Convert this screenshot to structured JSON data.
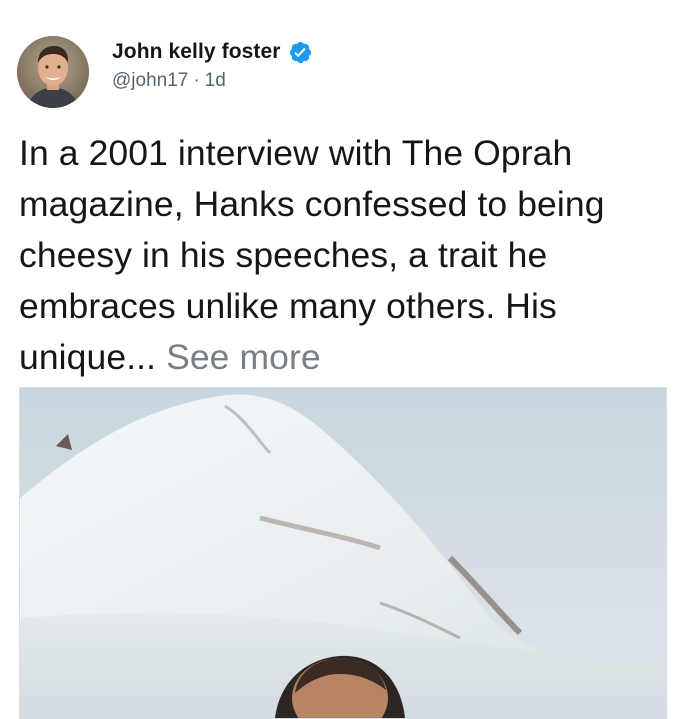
{
  "author": {
    "name": "John kelly foster",
    "verified": true,
    "handle": "@john17",
    "separator": "·",
    "time": "1d",
    "avatar_icon": "avatar-photo"
  },
  "post": {
    "text": "In a 2001 interview with The Oprah magazine, Hanks confessed to being cheesy in his speeches, a trait he embraces unlike many others. His unique...",
    "see_more": "See more"
  },
  "media": {
    "kind": "photo",
    "subject": "snowy-mountain-with-person"
  },
  "colors": {
    "text": "#14171a",
    "secondary": "#536471",
    "verified_blue": "#1d9bf0",
    "border": "#d8dde1"
  }
}
